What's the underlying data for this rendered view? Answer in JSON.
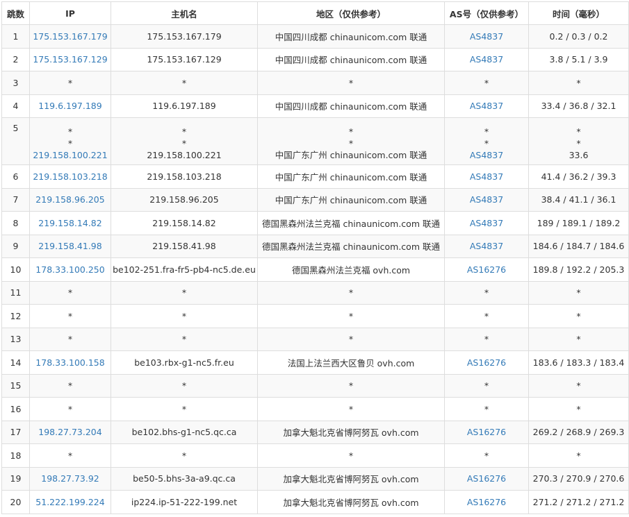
{
  "headers": [
    "跳数",
    "IP",
    "主机名",
    "地区（仅供参考）",
    "AS号（仅供参考）",
    "时间（毫秒）"
  ],
  "rows": [
    {
      "hop": "1",
      "lines": [
        {
          "ip": "175.153.167.179",
          "host": "175.153.167.179",
          "region": "中国四川成都 chinaunicom.com 联通",
          "as": "AS4837",
          "time": "0.2 / 0.3 / 0.2"
        }
      ]
    },
    {
      "hop": "2",
      "lines": [
        {
          "ip": "175.153.167.129",
          "host": "175.153.167.129",
          "region": "中国四川成都 chinaunicom.com 联通",
          "as": "AS4837",
          "time": "3.8 / 5.1 / 3.9"
        }
      ]
    },
    {
      "hop": "3",
      "lines": [
        {
          "ip": "*",
          "host": "*",
          "region": "*",
          "as": "*",
          "time": "*"
        }
      ]
    },
    {
      "hop": "4",
      "lines": [
        {
          "ip": "119.6.197.189",
          "host": "119.6.197.189",
          "region": "中国四川成都 chinaunicom.com 联通",
          "as": "AS4837",
          "time": "33.4 / 36.8 / 32.1"
        }
      ]
    },
    {
      "hop": "5",
      "lines": [
        {
          "ip": "*",
          "host": "*",
          "region": "*",
          "as": "*",
          "time": "*"
        },
        {
          "ip": "*",
          "host": "*",
          "region": "*",
          "as": "*",
          "time": "*"
        },
        {
          "ip": "219.158.100.221",
          "host": "219.158.100.221",
          "region": "中国广东广州 chinaunicom.com 联通",
          "as": "AS4837",
          "time": "33.6"
        }
      ]
    },
    {
      "hop": "6",
      "lines": [
        {
          "ip": "219.158.103.218",
          "host": "219.158.103.218",
          "region": "中国广东广州 chinaunicom.com 联通",
          "as": "AS4837",
          "time": "41.4 / 36.2 / 39.3"
        }
      ]
    },
    {
      "hop": "7",
      "lines": [
        {
          "ip": "219.158.96.205",
          "host": "219.158.96.205",
          "region": "中国广东广州 chinaunicom.com 联通",
          "as": "AS4837",
          "time": "38.4 / 41.1 / 36.1"
        }
      ]
    },
    {
      "hop": "8",
      "lines": [
        {
          "ip": "219.158.14.82",
          "host": "219.158.14.82",
          "region": "德国黑森州法兰克福 chinaunicom.com 联通",
          "as": "AS4837",
          "time": "189 / 189.1 / 189.2"
        }
      ]
    },
    {
      "hop": "9",
      "lines": [
        {
          "ip": "219.158.41.98",
          "host": "219.158.41.98",
          "region": "德国黑森州法兰克福 chinaunicom.com 联通",
          "as": "AS4837",
          "time": "184.6 / 184.7 / 184.6"
        }
      ]
    },
    {
      "hop": "10",
      "lines": [
        {
          "ip": "178.33.100.250",
          "host": "be102-251.fra-fr5-pb4-nc5.de.eu",
          "region": "德国黑森州法兰克福 ovh.com",
          "as": "AS16276",
          "time": "189.8 / 192.2 / 205.3"
        }
      ]
    },
    {
      "hop": "11",
      "lines": [
        {
          "ip": "*",
          "host": "*",
          "region": "*",
          "as": "*",
          "time": "*"
        }
      ]
    },
    {
      "hop": "12",
      "lines": [
        {
          "ip": "*",
          "host": "*",
          "region": "*",
          "as": "*",
          "time": "*"
        }
      ]
    },
    {
      "hop": "13",
      "lines": [
        {
          "ip": "*",
          "host": "*",
          "region": "*",
          "as": "*",
          "time": "*"
        }
      ]
    },
    {
      "hop": "14",
      "lines": [
        {
          "ip": "178.33.100.158",
          "host": "be103.rbx-g1-nc5.fr.eu",
          "region": "法国上法兰西大区鲁贝 ovh.com",
          "as": "AS16276",
          "time": "183.6 / 183.3 / 183.4"
        }
      ]
    },
    {
      "hop": "15",
      "lines": [
        {
          "ip": "*",
          "host": "*",
          "region": "*",
          "as": "*",
          "time": "*"
        }
      ]
    },
    {
      "hop": "16",
      "lines": [
        {
          "ip": "*",
          "host": "*",
          "region": "*",
          "as": "*",
          "time": "*"
        }
      ]
    },
    {
      "hop": "17",
      "lines": [
        {
          "ip": "198.27.73.204",
          "host": "be102.bhs-g1-nc5.qc.ca",
          "region": "加拿大魁北克省博阿努瓦 ovh.com",
          "as": "AS16276",
          "time": "269.2 / 268.9 / 269.3"
        }
      ]
    },
    {
      "hop": "18",
      "lines": [
        {
          "ip": "*",
          "host": "*",
          "region": "*",
          "as": "*",
          "time": "*"
        }
      ]
    },
    {
      "hop": "19",
      "lines": [
        {
          "ip": "198.27.73.92",
          "host": "be50-5.bhs-3a-a9.qc.ca",
          "region": "加拿大魁北克省博阿努瓦 ovh.com",
          "as": "AS16276",
          "time": "270.3 / 270.9 / 270.6"
        }
      ]
    },
    {
      "hop": "20",
      "lines": [
        {
          "ip": "51.222.199.224",
          "host": "ip224.ip-51-222-199.net",
          "region": "加拿大魁北克省博阿努瓦 ovh.com",
          "as": "AS16276",
          "time": "271.2 / 271.2 / 271.2"
        }
      ]
    }
  ],
  "colors": {
    "link": "#337ab7",
    "text": "#333333",
    "border": "#dddddd",
    "stripe": "#f9f9f9"
  }
}
